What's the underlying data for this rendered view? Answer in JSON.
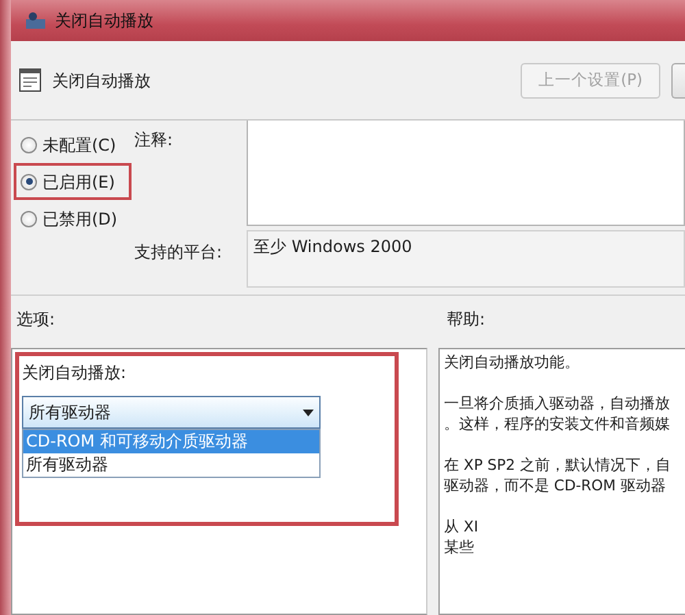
{
  "window": {
    "title": "关闭自动播放"
  },
  "header": {
    "title": "关闭自动播放",
    "buttons": [
      {
        "label": "上一个设置(P)",
        "disabled": true
      }
    ]
  },
  "radios": [
    {
      "label": "未配置(C)",
      "selected": false,
      "highlighted": false
    },
    {
      "label": "已启用(E)",
      "selected": true,
      "highlighted": true
    },
    {
      "label": "已禁用(D)",
      "selected": false,
      "highlighted": false
    }
  ],
  "comment": {
    "label": "注释:"
  },
  "platform": {
    "label": "支持的平台:",
    "value": "至少 Windows 2000"
  },
  "options": {
    "label": "选项:",
    "highlighted": true,
    "setting_label": "关闭自动播放:",
    "dropdown": {
      "value": "所有驱动器",
      "expanded": true,
      "options": [
        {
          "label": "CD-ROM 和可移动介质驱动器",
          "highlighted": true
        },
        {
          "label": "所有驱动器",
          "highlighted": false
        }
      ]
    }
  },
  "help": {
    "label": "帮助:",
    "paragraphs": [
      [
        "关闭自动播放功能。"
      ],
      [
        "一旦将介质插入驱动器，自动播放",
        "。这样，程序的安装文件和音频媒"
      ],
      [
        "在 XP SP2 之前，默认情况下，自",
        "驱动器，而不是 CD-ROM 驱动器"
      ],
      [
        "从 XI",
        "某些"
      ]
    ]
  }
}
